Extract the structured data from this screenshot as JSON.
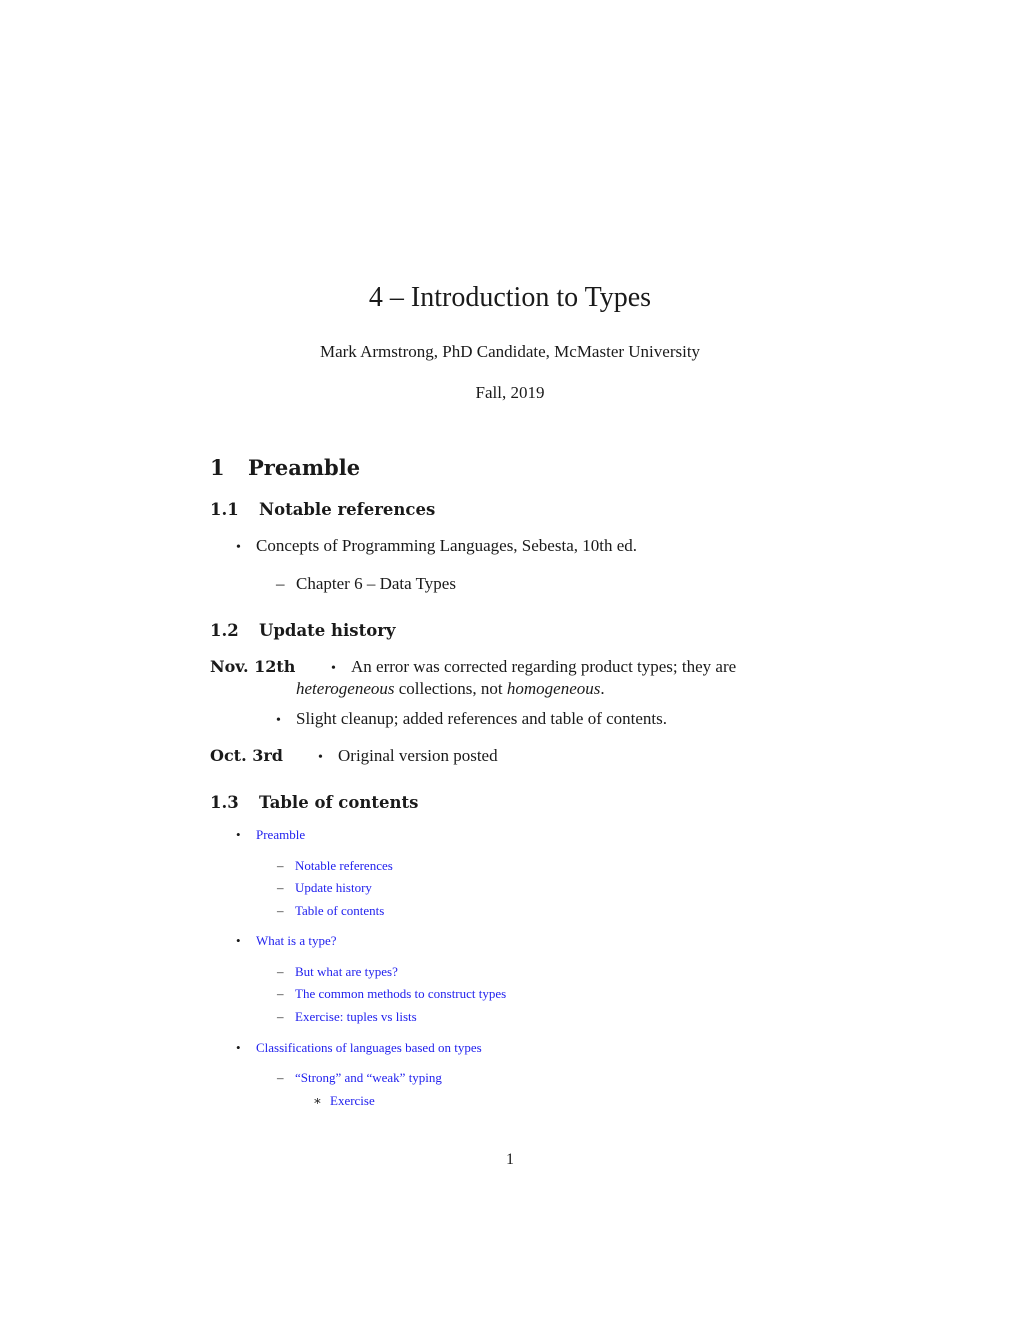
{
  "header": {
    "title": "4 – Introduction to Types",
    "author": "Mark Armstrong, PhD Candidate, McMaster University",
    "date": "Fall, 2019"
  },
  "section1": {
    "number": "1",
    "title": "Preamble",
    "refs": {
      "number": "1.1",
      "title": "Notable references",
      "items": [
        {
          "text": "Concepts of Programming Languages, Sebesta, 10th ed.",
          "sub": [
            "Chapter 6 – Data Types"
          ]
        }
      ]
    },
    "history": {
      "number": "1.2",
      "title": "Update history",
      "entries": [
        {
          "date": "Nov. 12th",
          "items": [
            {
              "pre": "An error was corrected regarding product types; they are",
              "em1": "heterogeneous",
              "mid": " collections, not ",
              "em2": "homogeneous",
              "post": "."
            },
            {
              "text": "Slight cleanup; added references and table of contents."
            }
          ]
        },
        {
          "date": "Oct. 3rd",
          "items": [
            {
              "text": "Original version posted"
            }
          ]
        }
      ]
    },
    "toc": {
      "number": "1.3",
      "title": "Table of contents",
      "items": [
        {
          "label": "Preamble",
          "children": [
            "Notable references",
            "Update history",
            "Table of contents"
          ]
        },
        {
          "label": "What is a type?",
          "children": [
            "But what are types?",
            "The common methods to construct types",
            "Exercise: tuples vs lists"
          ]
        },
        {
          "label": "Classifications of languages based on types",
          "children": [
            "“Strong” and “weak” typing"
          ],
          "grandchildren": [
            "Exercise"
          ]
        }
      ]
    }
  },
  "marks": {
    "bullet": "•",
    "dash": "–",
    "star": "∗"
  },
  "footer": {
    "page_number": "1"
  },
  "colors": {
    "link": "#2222ee",
    "text": "#1a1a1a"
  }
}
